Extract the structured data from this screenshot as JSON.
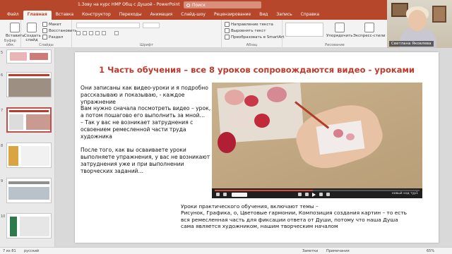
{
  "titlebar": {
    "doc_title": "1.Зову на курс НМР Общ с Душой  -  PowerPoint",
    "search_placeholder": "Поиск"
  },
  "tabs": [
    "Файл",
    "Главная",
    "Вставка",
    "Конструктор",
    "Переходы",
    "Анимация",
    "Слайд-шоу",
    "Рецензирование",
    "Вид",
    "Запись",
    "Справка"
  ],
  "active_tab": "Главная",
  "ribbon": {
    "groups": [
      "Буфер обм.",
      "Слайды",
      "Шрифт",
      "Абзац",
      "Рисование"
    ],
    "buttons": {
      "insert": "Вставить",
      "create_slide": "Создать слайд",
      "layout": "Макет",
      "reset": "Восстановить",
      "section": "Раздел",
      "text_direction": "Направление текста",
      "align_text": "Выровнять текст",
      "smartart": "Преобразовать в SmartArt",
      "arrange": "Упорядочить",
      "styles": "Экспресс-стили"
    }
  },
  "video_call": {
    "participant_name": "Светлана Яковлева"
  },
  "thumbnails": [
    {
      "num": "5"
    },
    {
      "num": "6"
    },
    {
      "num": "7",
      "selected": true
    },
    {
      "num": "8"
    },
    {
      "num": "9"
    },
    {
      "num": "10"
    }
  ],
  "slide": {
    "title": "1 Часть обучения – все 8 уроков сопровождаются видео - уроками",
    "left_text": "Они записаны как видео-уроки и я подробно рассказываю и показываю, -  каждое упражнение\nВам нужно сначала посмотреть видео – урок,  а потом пошагово его выполнить за мной…\n– Так у вас не возникает затруднения с освоением ремесленной части труда художника\n\nПосле того, как вы осваиваете уроки выполняете упражнения, у вас не возникают затруднения уже и при выполнении творческих заданий…",
    "caption": "Уроки практического обучения, включают темы –\n  Рисунок,  Графика,  о,  Цветовые гармонии, Композиция создания картин – то есть вся ремесленная часть для фиксации ответа от Души, потому что наша  Душа сама является художником, нашим творческим началом",
    "video_label": "новый ход тур1",
    "video_progress": 0.48
  },
  "status": {
    "slide_info": "7 из 81",
    "language": "русский",
    "notes": "Заметки",
    "comments": "Примечания",
    "zoom": "65%"
  },
  "colors": {
    "accent": "#b7472a",
    "title_red": "#c0392b"
  }
}
